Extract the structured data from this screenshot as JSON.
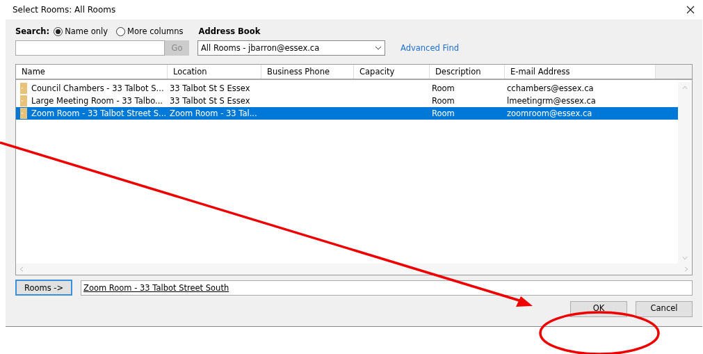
{
  "window": {
    "title": "Select Rooms: All Rooms"
  },
  "search": {
    "label": "Search:",
    "options": [
      {
        "label": "Name only",
        "selected": true
      },
      {
        "label": "More columns",
        "selected": false
      }
    ],
    "go_button": "Go",
    "go_disabled": true
  },
  "address_book": {
    "label": "Address Book",
    "value": "All Rooms - jbarron@essex.ca",
    "advanced_find": "Advanced Find"
  },
  "table": {
    "columns": [
      "Name",
      "Location",
      "Business Phone",
      "Capacity",
      "Description",
      "E-mail Address"
    ],
    "rows": [
      {
        "cells": [
          "Council Chambers - 33 Talbot S...",
          "33 Talbot St S Essex",
          "",
          "",
          "Room",
          "cchambers@essex.ca"
        ],
        "selected": false
      },
      {
        "cells": [
          "Large Meeting Room - 33 Talbo...",
          "33 Talbot St S Essex",
          "",
          "",
          "Room",
          "lmeetingrm@essex.ca"
        ],
        "selected": false
      },
      {
        "cells": [
          "Zoom Room - 33 Talbot Street S...",
          "Zoom Room - 33 Tal...",
          "",
          "",
          "Room",
          "zoomroom@essex.ca"
        ],
        "selected": true
      }
    ]
  },
  "rooms_button": "Rooms ->",
  "rooms_value": "Zoom Room - 33 Talbot Street South",
  "buttons": [
    "OK",
    "Cancel"
  ],
  "annotation": {
    "arrow": true,
    "ellipse": true
  }
}
